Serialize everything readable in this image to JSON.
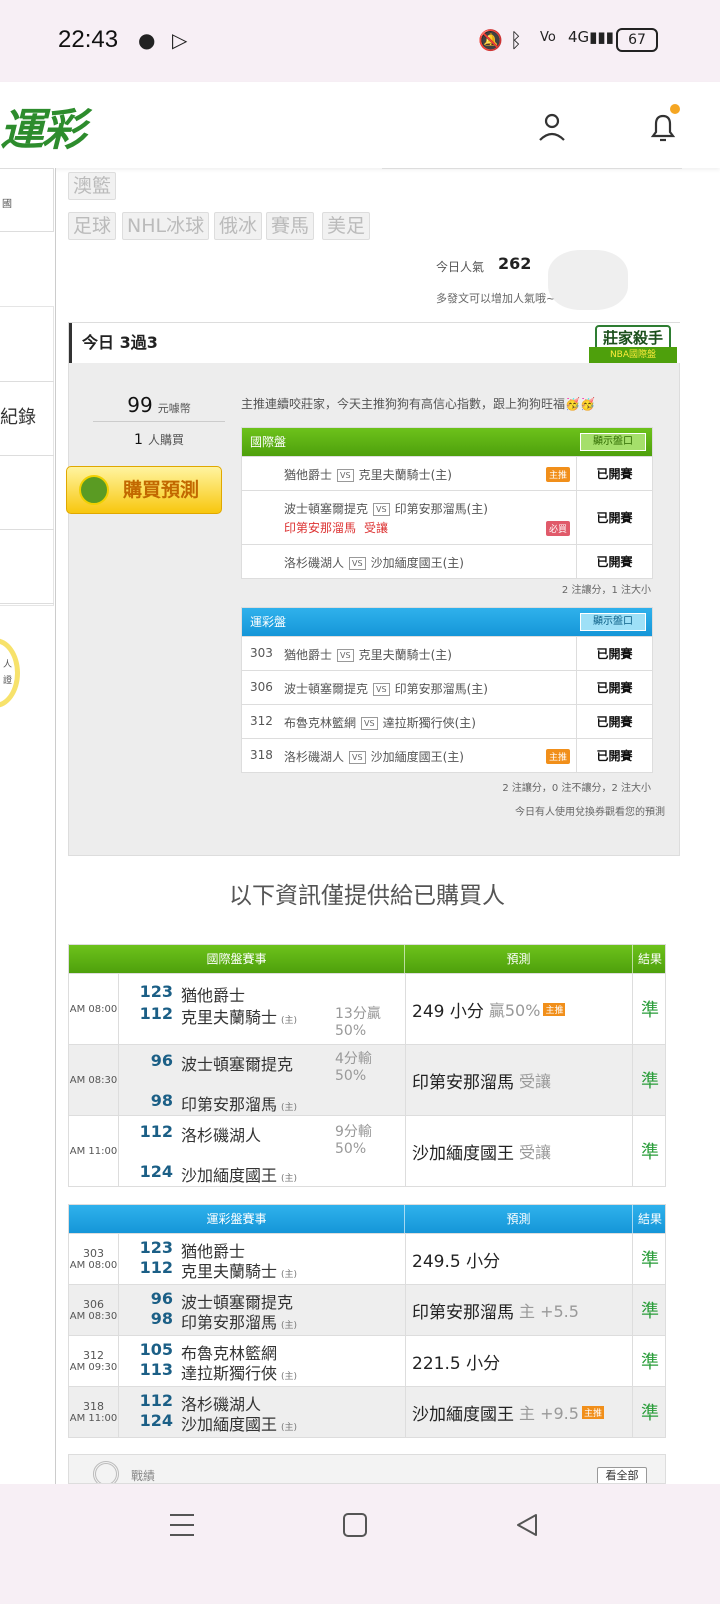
{
  "status_bar": {
    "time": "22:43",
    "battery": "67"
  },
  "header": {
    "logo_text": "運彩"
  },
  "left_rail": {
    "item1": "國",
    "item2": "紀錄",
    "item3": "人",
    "item4": "證"
  },
  "tags": [
    "澳籃",
    "足球",
    "NHL冰球",
    "俄冰",
    "賽馬",
    "美足"
  ],
  "popularity": {
    "label": "今日人氣",
    "value": "262",
    "hint": "多發文可以增加人氣哦~"
  },
  "panel": {
    "title": "今日 3過3",
    "badge_text": "莊家殺手",
    "badge_sub": "NBA國際盤",
    "price": "99",
    "price_unit": "元噱幣",
    "buyers": "1",
    "buyers_unit": "人購買",
    "buy_button": "購買預測",
    "description": "主推連續咬莊家，今天主推狗狗有高信心指數，跟上狗狗旺福🥳🥳",
    "intl": {
      "title": "國際盤",
      "show_btn": "顯示盤口",
      "rows": [
        {
          "away": "猶他爵士",
          "vs": "VS",
          "home": "克里夫蘭騎士(主)",
          "badge": "主推",
          "extra": "",
          "extra2": "",
          "badge2": "",
          "result": "已開賽"
        },
        {
          "away": "波士頓塞爾提克",
          "vs": "VS",
          "home": "印第安那溜馬(主)",
          "badge": "",
          "extra": "印第安那溜馬",
          "extra2": "受讓",
          "badge2": "必買",
          "result": "已開賽"
        },
        {
          "away": "洛杉磯湖人",
          "vs": "VS",
          "home": "沙加緬度國王(主)",
          "badge": "",
          "extra": "",
          "extra2": "",
          "badge2": "",
          "result": "已開賽"
        }
      ],
      "summary": "2 注讓分，1 注大小"
    },
    "yuncai": {
      "title": "運彩盤",
      "show_btn": "顯示盤口",
      "rows": [
        {
          "no": "303",
          "away": "猶他爵士",
          "vs": "VS",
          "home": "克里夫蘭騎士(主)",
          "badge": "",
          "result": "已開賽"
        },
        {
          "no": "306",
          "away": "波士頓塞爾提克",
          "vs": "VS",
          "home": "印第安那溜馬(主)",
          "badge": "",
          "result": "已開賽"
        },
        {
          "no": "312",
          "away": "布魯克林籃網",
          "vs": "VS",
          "home": "達拉斯獨行俠(主)",
          "badge": "",
          "result": "已開賽"
        },
        {
          "no": "318",
          "away": "洛杉磯湖人",
          "vs": "VS",
          "home": "沙加緬度國王(主)",
          "badge": "主推",
          "result": "已開賽"
        }
      ],
      "summary": "2 注讓分，0 注不讓分，2 注大小"
    },
    "footnote": "今日有人使用兌換券觀看您的預測"
  },
  "buyer_info_title": "以下資訊僅提供給已購買人",
  "results_intl": {
    "headers": {
      "game": "國際盤賽事",
      "pred": "預測",
      "result": "結果"
    },
    "rows": [
      {
        "time": "AM 08:00",
        "n1": "123",
        "t1": "猶他爵士",
        "n2": "112",
        "t2": "克里夫蘭騎士",
        "home": "(主)",
        "note1": "13分贏",
        "note2": "50%",
        "pred": "249 小分",
        "pred_extra": "贏50%",
        "pred_badge": "主推",
        "result": "準"
      },
      {
        "time": "AM 08:30",
        "n1": "96",
        "t1": "波士頓塞爾提克",
        "n2": "98",
        "t2": "印第安那溜馬",
        "home": "(主)",
        "note1": "4分輸",
        "note2": "50%",
        "pred": "印第安那溜馬",
        "pred_extra": "受讓",
        "pred_badge": "",
        "result": "準"
      },
      {
        "time": "AM 11:00",
        "n1": "112",
        "t1": "洛杉磯湖人",
        "n2": "124",
        "t2": "沙加緬度國王",
        "home": "(主)",
        "note1": "9分輸",
        "note2": "50%",
        "pred": "沙加緬度國王",
        "pred_extra": "受讓",
        "pred_badge": "",
        "result": "準"
      }
    ]
  },
  "results_yuncai": {
    "headers": {
      "game": "運彩盤賽事",
      "pred": "預測",
      "result": "結果"
    },
    "rows": [
      {
        "no": "303",
        "time": "AM 08:00",
        "n1": "123",
        "t1": "猶他爵士",
        "n2": "112",
        "t2": "克里夫蘭騎士",
        "home": "(主)",
        "pred": "249.5 小分",
        "pred_extra": "",
        "pred_badge": "",
        "result": "準"
      },
      {
        "no": "306",
        "time": "AM 08:30",
        "n1": "96",
        "t1": "波士頓塞爾提克",
        "n2": "98",
        "t2": "印第安那溜馬",
        "home": "(主)",
        "pred": "印第安那溜馬",
        "pred_extra": "主 +5.5",
        "pred_badge": "",
        "result": "準"
      },
      {
        "no": "312",
        "time": "AM 09:30",
        "n1": "105",
        "t1": "布魯克林籃網",
        "n2": "113",
        "t2": "達拉斯獨行俠",
        "home": "(主)",
        "pred": "221.5 小分",
        "pred_extra": "",
        "pred_badge": "",
        "result": "準"
      },
      {
        "no": "318",
        "time": "AM 11:00",
        "n1": "112",
        "t1": "洛杉磯湖人",
        "n2": "124",
        "t2": "沙加緬度國王",
        "home": "(主)",
        "pred": "沙加緬度國王",
        "pred_extra": "主 +9.5",
        "pred_badge": "主推",
        "result": "準"
      }
    ]
  },
  "record": {
    "label": "戰績",
    "see_all": "看全部"
  },
  "colors": {
    "green": "#5cb312",
    "blue": "#1ea3e2",
    "accent": "#f18f1a",
    "correct": "#2a9d3a"
  }
}
